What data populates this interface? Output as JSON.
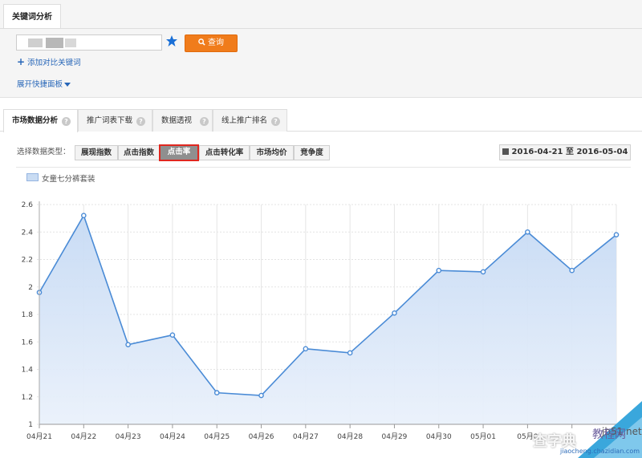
{
  "top_tab": "关键词分析",
  "search": {
    "value": ""
  },
  "query_button": "查询",
  "add_compare": "添加对比关键词",
  "expand_panel": "展开快捷面板",
  "tabs": [
    {
      "label": "市场数据分析"
    },
    {
      "label": "推广词表下载"
    },
    {
      "label": "数据透视"
    },
    {
      "label": "线上推广排名"
    }
  ],
  "data_type_label": "选择数据类型：",
  "data_types": [
    {
      "label": "展现指数"
    },
    {
      "label": "点击指数"
    },
    {
      "label": "点击率"
    },
    {
      "label": "点击转化率"
    },
    {
      "label": "市场均价"
    },
    {
      "label": "竞争度"
    }
  ],
  "date_range": "2016-04-21 至 2016-05-04",
  "colors": {
    "accent": "#f07c1b",
    "link": "#2766b8",
    "line": "#4a8bd6",
    "fill": "#d6e4f7",
    "selected_border": "#e0271f"
  },
  "watermark": {
    "main": "查字典",
    "tag": "教程网",
    "url": "jiaocheng.chazidian.com",
    "corner": "jb51.net"
  },
  "chart_data": {
    "type": "area",
    "series": [
      {
        "name": "女童七分裤套装",
        "values": [
          1.96,
          2.52,
          1.58,
          1.65,
          1.23,
          1.21,
          1.55,
          1.52,
          1.81,
          2.12,
          2.11,
          2.4,
          2.12,
          2.38
        ]
      }
    ],
    "categories": [
      "04月21",
      "04月22",
      "04月23",
      "04月24",
      "04月25",
      "04月26",
      "04月27",
      "04月28",
      "04月29",
      "04月30",
      "05月01",
      "05月0",
      "",
      ""
    ],
    "ylim": [
      1,
      2.6
    ],
    "yticks": [
      "1",
      "1.2",
      "1.4",
      "1.6",
      "1.8",
      "2",
      "2.2",
      "2.4",
      "2.6"
    ],
    "grid": true
  }
}
